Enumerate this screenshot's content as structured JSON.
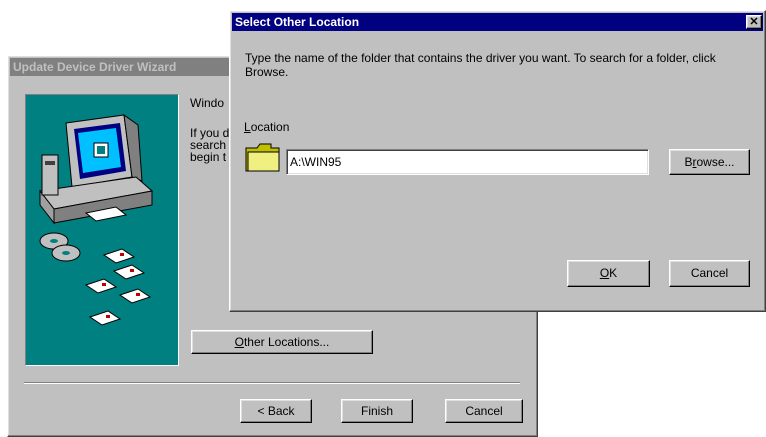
{
  "wizard": {
    "title": "Update Device Driver Wizard",
    "text_line1": "Windo",
    "text_line2a": "If you d",
    "text_line2b": "search",
    "text_line2c": "begin t",
    "other_locations_button": "Other Locations...",
    "other_locations_mnemonic": "O",
    "back_button": "< Back",
    "back_mnemonic": "B",
    "finish_button": "Finish",
    "cancel_button": "Cancel"
  },
  "dialog": {
    "title": "Select Other Location",
    "instructions": "Type the name of the folder that contains the driver you want. To search for a folder, click Browse.",
    "location_label": "Location",
    "location_mnemonic": "L",
    "location_value": "A:\\WIN95",
    "browse_button": "Browse...",
    "browse_mnemonic": "r",
    "ok_button": "OK",
    "ok_mnemonic": "O",
    "cancel_button": "Cancel",
    "close_icon": "close-icon"
  },
  "colors": {
    "title_active": "#000080",
    "title_inactive": "#808080",
    "face": "#c0c0c0",
    "wizard_panel": "#008080"
  }
}
